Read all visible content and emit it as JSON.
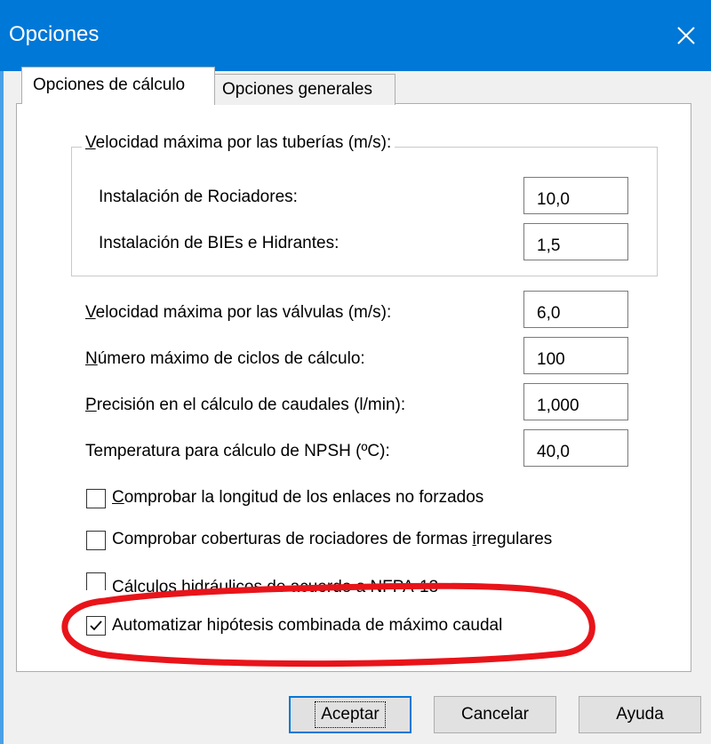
{
  "window": {
    "title": "Opciones",
    "close_icon": "close-icon"
  },
  "tabs": [
    {
      "label": "Opciones de cálculo",
      "active": true
    },
    {
      "label": "Opciones generales",
      "active": false
    }
  ],
  "velocity_group": {
    "legend": "Velocidad máxima por las tuberías (m/s):",
    "legend_underline": "V",
    "rows": [
      {
        "label": "Instalación de Rociadores:",
        "value": "10,0"
      },
      {
        "label": "Instalación de BIEs e Hidrantes:",
        "value": "1,5"
      }
    ]
  },
  "fields": [
    {
      "label": "Velocidad máxima por las válvulas (m/s):",
      "underline": "V",
      "value": "6,0"
    },
    {
      "label": "Número máximo de ciclos de cálculo:",
      "underline": "N",
      "value": "100"
    },
    {
      "label": "Precisión en el cálculo de caudales (l/min):",
      "underline": "P",
      "value": "1,000"
    },
    {
      "label": "Temperatura para cálculo de NPSH (ºC):",
      "underline": "",
      "value": "40,0"
    }
  ],
  "checkboxes": [
    {
      "label": "Comprobar la longitud de los enlaces no forzados",
      "checked": false
    },
    {
      "label": "Comprobar coberturas de rociadores de formas irregulares",
      "checked": false
    },
    {
      "label": "Cálculos hidráulicos de acuerdo a NFPA-13",
      "checked": false
    },
    {
      "label": "Automatizar hipótesis combinada de máximo caudal",
      "checked": true
    }
  ],
  "buttons": {
    "ok": "Aceptar",
    "cancel": "Cancelar",
    "help": "Ayuda"
  },
  "colors": {
    "titlebar": "#0078d7",
    "highlight_ellipse": "#e8141a"
  }
}
